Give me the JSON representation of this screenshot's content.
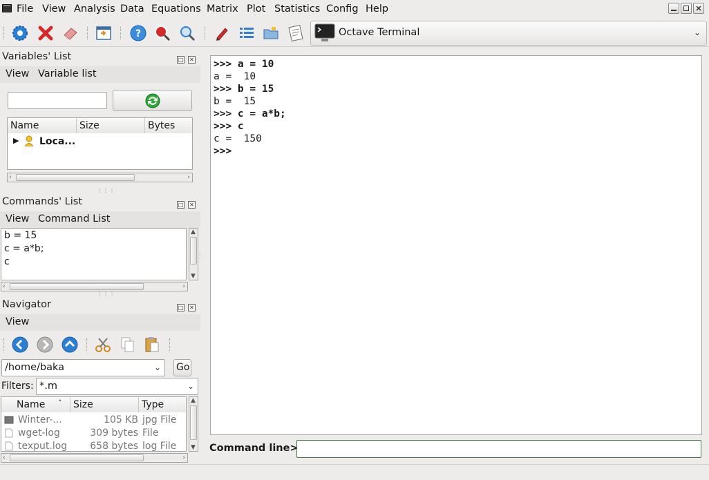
{
  "menu": [
    "File",
    "View",
    "Analysis",
    "Data",
    "Equations",
    "Matrix",
    "Plot",
    "Statistics",
    "Config",
    "Help"
  ],
  "window_buttons": [
    "minimize",
    "restore",
    "close"
  ],
  "toolbar": {
    "terminal_combo": "Octave Terminal"
  },
  "variables_panel": {
    "title": "Variables' List",
    "submenu": [
      "View",
      "Variable list"
    ],
    "search_value": "",
    "columns": [
      "Name",
      "Size",
      "Bytes"
    ],
    "rows": [
      {
        "name": "Loca..."
      }
    ]
  },
  "commands_panel": {
    "title": "Commands' List",
    "submenu": [
      "View",
      "Command List"
    ],
    "items": [
      "b = 15",
      "c = a*b;",
      "c"
    ]
  },
  "navigator_panel": {
    "title": "Navigator",
    "submenu": [
      "View"
    ],
    "path": "/home/baka",
    "go_label": "Go",
    "filters_label": "Filters:",
    "filter_value": "*.m",
    "columns": [
      "Name",
      "Size",
      "Type"
    ],
    "files": [
      {
        "name": "Winter-...",
        "size": "105 KB",
        "type": "jpg File"
      },
      {
        "name": "wget-log",
        "size": "309 bytes",
        "type": "File"
      },
      {
        "name": "texput.log",
        "size": "658 bytes",
        "type": "log File"
      }
    ]
  },
  "terminal": {
    "lines": [
      {
        "text": ">>> a = 10",
        "bold": true
      },
      {
        "text": "a =  10",
        "bold": false
      },
      {
        "text": ">>> b = 15",
        "bold": true
      },
      {
        "text": "b =  15",
        "bold": false
      },
      {
        "text": ">>> c = a*b;",
        "bold": true
      },
      {
        "text": ">>> c",
        "bold": true
      },
      {
        "text": "c =  150",
        "bold": false
      },
      {
        "text": ">>>",
        "bold": true
      }
    ]
  },
  "command_line": {
    "label": "Command line>>",
    "value": ""
  },
  "colors": {
    "background": "#edeceb",
    "accent_green": "#3e7a3e",
    "icon_blue": "#2d7fd3",
    "icon_red": "#d42a2a"
  }
}
